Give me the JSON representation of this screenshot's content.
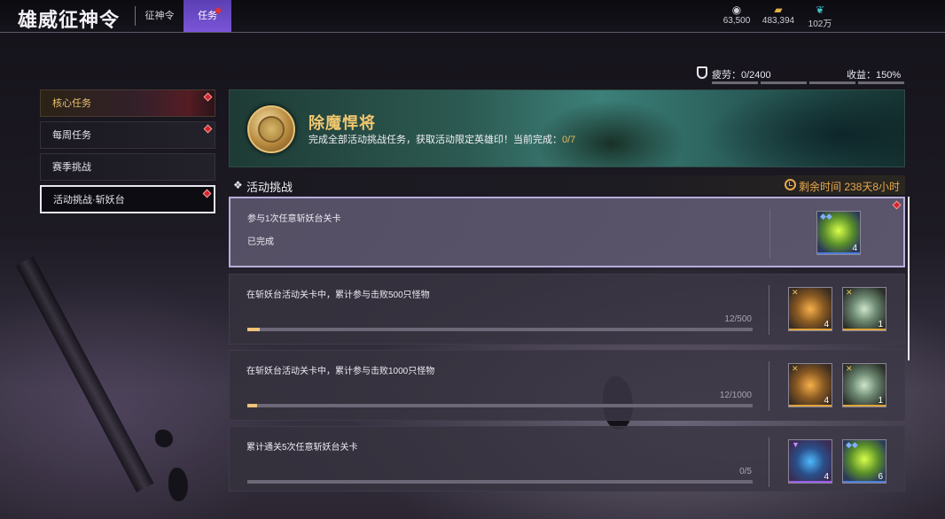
{
  "header": {
    "title": "雄威征神令",
    "tabs": [
      {
        "label": "征神令",
        "active": false
      },
      {
        "label": "任务",
        "active": true,
        "has_alert": true
      }
    ],
    "currencies": [
      {
        "icon": "coin-stack-icon",
        "value": "63,500"
      },
      {
        "icon": "gold-ticket-icon",
        "value": "483,394"
      },
      {
        "icon": "feather-icon",
        "value": "102万"
      }
    ]
  },
  "stats": {
    "fatigue_label": "疲劳：0/2400",
    "income_label": "收益：150%"
  },
  "sidebar": {
    "items": [
      {
        "label": "核心任务",
        "selected": false,
        "has_alert": true
      },
      {
        "label": "每周任务",
        "selected": false,
        "has_alert": true
      },
      {
        "label": "赛季挑战",
        "selected": false,
        "has_alert": false
      },
      {
        "label": "活动挑战·斩妖台",
        "selected": true,
        "has_alert": true
      }
    ]
  },
  "banner": {
    "title": "除魔悍将",
    "desc_prefix": "完成全部活动挑战任务，获取活动限定英雄印！当前完成：",
    "progress": "0/7"
  },
  "section": {
    "title": "活动挑战",
    "timer": "剩余时间 238天8小时"
  },
  "tasks": [
    {
      "desc": "参与1次任意斩妖台关卡",
      "status": "已完成",
      "completed": true,
      "rewards": [
        {
          "icon": "jade-crystal-icon",
          "qty": "4",
          "rarity": "blue"
        }
      ]
    },
    {
      "desc": "在斩妖台活动关卡中，累计参与击败500只怪物",
      "count": "12/500",
      "progress": 0.024,
      "rewards": [
        {
          "icon": "amber-crystal-icon",
          "qty": "4",
          "rarity": "gold"
        },
        {
          "icon": "dice-stone-icon",
          "qty": "1",
          "rarity": "gold"
        }
      ]
    },
    {
      "desc": "在斩妖台活动关卡中，累计参与击败1000只怪物",
      "count": "12/1000",
      "progress": 0.012,
      "rewards": [
        {
          "icon": "amber-crystal-icon",
          "qty": "4",
          "rarity": "gold"
        },
        {
          "icon": "dice-stone-icon",
          "qty": "1",
          "rarity": "gold"
        }
      ]
    },
    {
      "desc": "累计通关5次任意斩妖台关卡",
      "count": "0/5",
      "progress": 0,
      "rewards": [
        {
          "icon": "blue-gem-icon",
          "qty": "4",
          "rarity": "purple"
        },
        {
          "icon": "jade-crystal-icon",
          "qty": "6",
          "rarity": "blue"
        }
      ]
    }
  ],
  "colors": {
    "accent_gold": "#e8a94e",
    "tab_active": "#6b4bc8",
    "alert_red": "#d3242a"
  }
}
